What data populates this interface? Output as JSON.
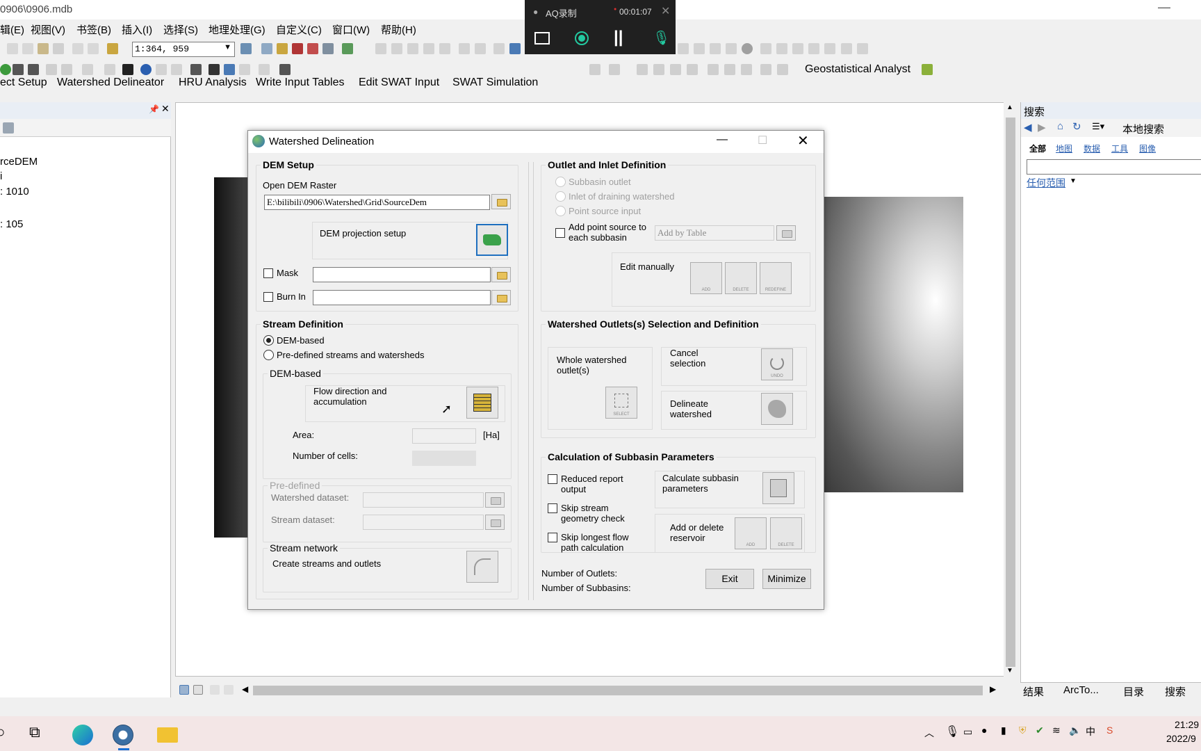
{
  "window": {
    "title": "0906\\0906.mdb"
  },
  "menu": [
    "辑(E)",
    "视图(V)",
    "书签(B)",
    "插入(I)",
    "选择(S)",
    "地理处理(G)",
    "自定义(C)",
    "窗口(W)",
    "帮助(H)"
  ],
  "toolbar": {
    "scale": "1:364, 959",
    "geostat_label": "Geostatistical Analyst"
  },
  "swat_menu": [
    "ect Setup",
    "Watershed Delineator",
    "HRU Analysis",
    "Write Input Tables",
    "Edit SWAT Input",
    "SWAT Simulation"
  ],
  "left_panel": {
    "items": [
      "rceDEM",
      "i",
      ": 1010",
      ": 105"
    ]
  },
  "recorder": {
    "title": "AQ录制",
    "time": "00:01:07"
  },
  "search_panel": {
    "title": "搜索",
    "scope": "本地搜索",
    "tabs": [
      "全部",
      "地图",
      "数据",
      "工具",
      "图像"
    ],
    "extent": "任何范围",
    "bottom_tabs": [
      "结果",
      "ArcTo...",
      "目录",
      "搜索"
    ]
  },
  "dialog": {
    "title": "Watershed Delineation",
    "dem_setup": {
      "title": "DEM Setup",
      "open_label": "Open DEM Raster",
      "path": "E:\\bilibili\\0906\\Watershed\\Grid\\SourceDem",
      "projection_label": "DEM projection setup",
      "mask_label": "Mask",
      "burn_label": "Burn In"
    },
    "stream_def": {
      "title": "Stream Definition",
      "opt_dem": "DEM-based",
      "opt_predef": "Pre-defined streams and watersheds",
      "dem_based_title": "DEM-based",
      "flow_label": "Flow direction and accumulation",
      "area_label": "Area:",
      "area_unit": "[Ha]",
      "cells_label": "Number of cells:",
      "predef_title": "Pre-defined",
      "watershed_ds": "Watershed dataset:",
      "stream_ds": "Stream dataset:",
      "network_title": "Stream network",
      "create_label": "Create streams and outlets"
    },
    "outlet_def": {
      "title": "Outlet and Inlet Definition",
      "opt_subbasin": "Subbasin outlet",
      "opt_inlet": "Inlet of draining watershed",
      "opt_point": "Point source input",
      "add_point_label": "Add point source to each subbasin",
      "add_by_table": "Add by Table",
      "edit_manually": "Edit manually",
      "btn_labels": [
        "ADD",
        "DELETE",
        "REDEFINE"
      ]
    },
    "outlet_sel": {
      "title": "Watershed Outlets(s) Selection and Definition",
      "whole_label": "Whole watershed outlet(s)",
      "whole_btn_label": "SELECT",
      "cancel_label": "Cancel selection",
      "cancel_btn_label": "UNDO",
      "delineate_label": "Delineate watershed"
    },
    "calc": {
      "title": "Calculation of Subbasin Parameters",
      "reduced": "Reduced report output",
      "skip_stream": "Skip stream geometry check",
      "skip_longest": "Skip longest flow path calculation",
      "calc_label": "Calculate subbasin parameters",
      "reservoir_label": "Add or delete reservoir",
      "res_btns": [
        "ADD",
        "DELETE"
      ]
    },
    "footer": {
      "outlets": "Number of Outlets:",
      "subbasins": "Number of Subbasins:",
      "exit": "Exit",
      "minimize": "Minimize"
    }
  },
  "taskbar": {
    "time": "21:29",
    "date": "2022/9"
  }
}
